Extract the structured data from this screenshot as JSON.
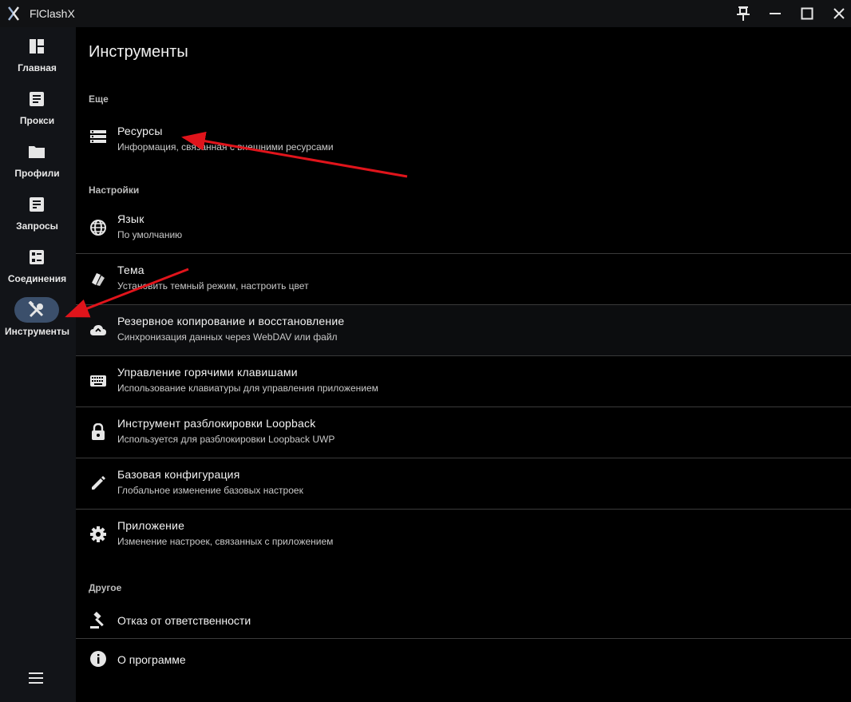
{
  "app": {
    "title": "FlClashX"
  },
  "nav": {
    "items": [
      {
        "label": "Главная",
        "icon": "dashboard-icon"
      },
      {
        "label": "Прокси",
        "icon": "article-icon"
      },
      {
        "label": "Профили",
        "icon": "folder-icon"
      },
      {
        "label": "Запросы",
        "icon": "request-list-icon"
      },
      {
        "label": "Соединения",
        "icon": "connections-icon"
      },
      {
        "label": "Инструменты",
        "icon": "tools-icon",
        "selected": true
      }
    ],
    "menu_icon": "hamburger-menu-icon"
  },
  "page": {
    "title": "Инструменты"
  },
  "sections": {
    "more": "Еще",
    "settings": "Настройки",
    "other": "Другое"
  },
  "items": {
    "resources": {
      "title": "Ресурсы",
      "subtitle": "Информация, связанная с внешними ресурсами",
      "icon": "storage-icon"
    },
    "language": {
      "title": "Язык",
      "subtitle": "По умолчанию",
      "icon": "globe-icon"
    },
    "theme": {
      "title": "Тема",
      "subtitle": "Установить темный режим, настроить цвет",
      "icon": "palette-icon"
    },
    "backup": {
      "title": "Резервное копирование и восстановление",
      "subtitle": "Синхронизация данных через WebDAV или файл",
      "icon": "cloud-sync-icon"
    },
    "hotkeys": {
      "title": "Управление горячими клавишами",
      "subtitle": "Использование клавиатуры для управления приложением",
      "icon": "keyboard-icon"
    },
    "loopback": {
      "title": "Инструмент разблокировки Loopback",
      "subtitle": "Используется для разблокировки Loopback UWP",
      "icon": "lock-icon"
    },
    "base_config": {
      "title": "Базовая конфигурация",
      "subtitle": "Глобальное изменение базовых настроек",
      "icon": "edit-icon"
    },
    "application": {
      "title": "Приложение",
      "subtitle": "Изменение настроек, связанных с приложением",
      "icon": "settings-icon"
    },
    "disclaimer": {
      "title": "Отказ от ответственности",
      "icon": "gavel-icon"
    },
    "about": {
      "title": "О программе",
      "icon": "info-icon"
    }
  },
  "colors": {
    "accent_pill": "#3b4f6b",
    "annotation_arrow": "#e0141b"
  }
}
